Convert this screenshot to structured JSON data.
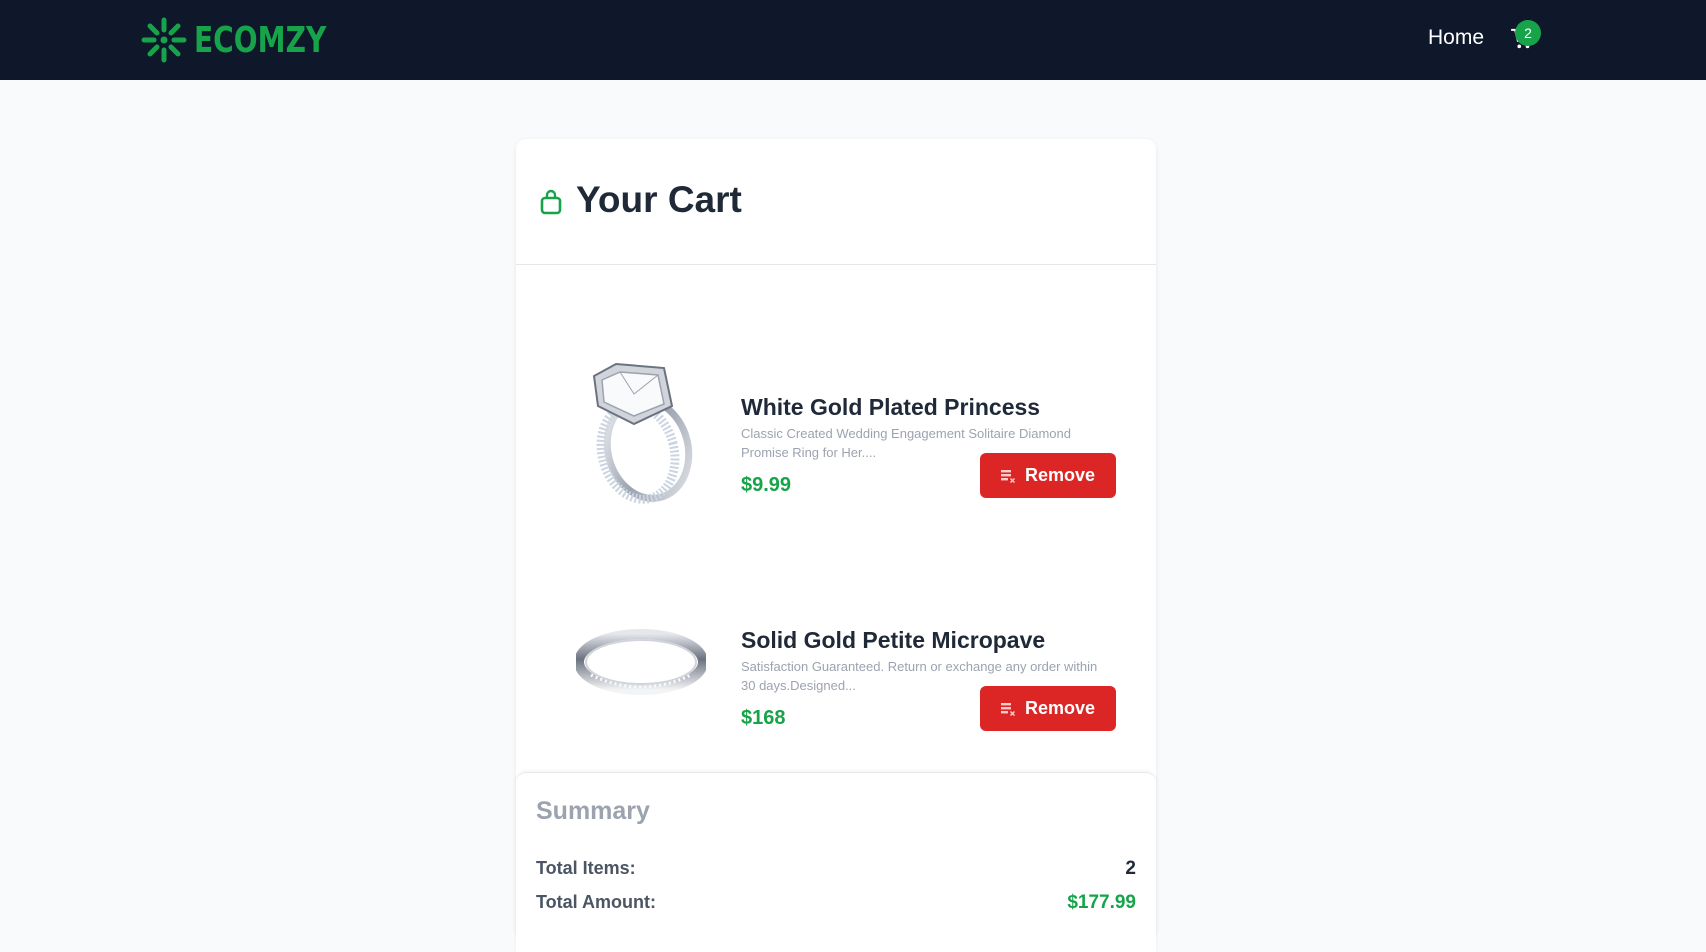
{
  "navbar": {
    "logo_text": "ECOMZY",
    "home_label": "Home",
    "cart_count": "2",
    "brand_color": "#16a34a",
    "bg_color": "#0f172a"
  },
  "cart": {
    "title": "Your Cart",
    "items": [
      {
        "title": "White Gold Plated Princess",
        "description": "Classic Created Wedding Engagement Solitaire Diamond Promise Ring for Her....",
        "price": "$9.99",
        "remove_label": "Remove",
        "image_icon": "engagement-ring-image"
      },
      {
        "title": "Solid Gold Petite Micropave",
        "description": "Satisfaction Guaranteed. Return or exchange any order within 30 days.Designed...",
        "price": "$168",
        "remove_label": "Remove",
        "image_icon": "band-ring-image"
      }
    ]
  },
  "summary": {
    "title": "Summary",
    "total_items_label": "Total Items:",
    "total_items_value": "2",
    "total_amount_label": "Total Amount:",
    "total_amount_value": "$177.99"
  },
  "colors": {
    "accent": "#16a34a",
    "danger": "#dc2626"
  }
}
